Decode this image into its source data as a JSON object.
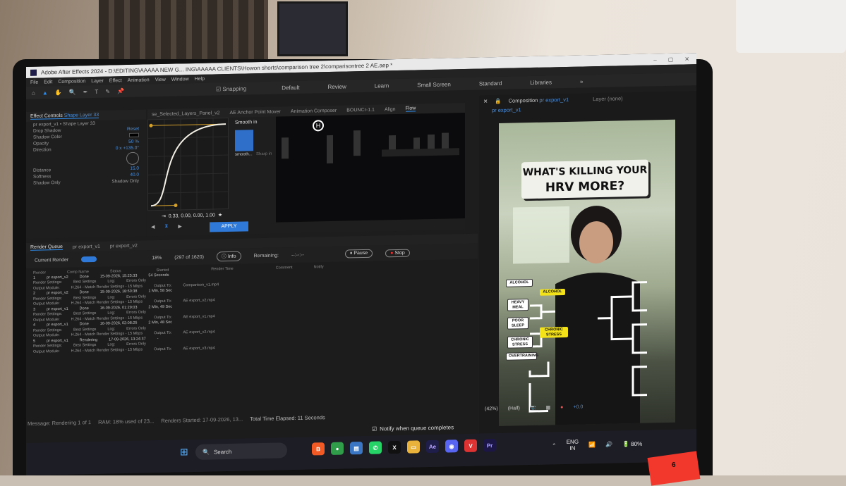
{
  "window": {
    "title": "Adobe After Effects 2024 - D:\\EDITING\\AAAAA NEW G... ING\\AAAAA CLIENTS\\Howon shorts\\comparison tree 2\\comparisontree 2 AE.aep *"
  },
  "menu": [
    "File",
    "Edit",
    "Composition",
    "Layer",
    "Effect",
    "Animation",
    "View",
    "Window",
    "Help"
  ],
  "toolbar": {
    "snapping": "Snapping",
    "workspaces": [
      "Default",
      "Review",
      "Learn",
      "Small Screen",
      "Standard",
      "Libraries"
    ]
  },
  "effect_controls": {
    "tab": "Effect Controls",
    "layer": "Shape Layer 33",
    "layer_path": "pr export_v1 • Shape Layer 33",
    "effect": "Drop Shadow",
    "reset": "Reset",
    "props": [
      {
        "label": "Shadow Color",
        "value": ""
      },
      {
        "label": "Opacity",
        "value": "50 %"
      },
      {
        "label": "Direction",
        "value": "0 x +135.0°"
      },
      {
        "label": "Distance",
        "value": "15.0"
      },
      {
        "label": "Softness",
        "value": "40.0"
      },
      {
        "label": "Shadow Only",
        "value": "Shadow Only"
      }
    ]
  },
  "flow": {
    "tabs": [
      "se_Selected_Layers_Panel_v2",
      "AE Anchor Point Mover",
      "Animation Composer",
      "BOUNCr-1.1",
      "Align",
      "Flow"
    ],
    "active_tab": "Flow",
    "preset_header": "Smooth in",
    "presets": [
      "smooth...",
      "Sharp in"
    ],
    "coords": "0.33, 0.00, 0.00, 1.00",
    "apply": "APPLY",
    "graph_p1": 0.33,
    "graph_p2": 0.0,
    "graph_p3": 0.0,
    "graph_p4": 1.0
  },
  "render_queue": {
    "tabs": [
      "Render Queue",
      "pr export_v1",
      "pr export_v2"
    ],
    "current_render": "Current Render",
    "percent": "18%",
    "frames": "(297 of 1620)",
    "info": "Info",
    "remaining_label": "Remaining:",
    "remaining": "--:--:--",
    "pause": "Pause",
    "stop": "Stop",
    "columns": [
      "Render",
      "Comp Name",
      "Status",
      "Started",
      "Render Time",
      "Comment",
      "Notify"
    ],
    "items": [
      {
        "num": "1",
        "comp": "pr export_v2",
        "status": "Done",
        "started": "15-09-2026, 15:25:33",
        "time": "54 Seconds",
        "log": "Errors Only",
        "output": "Comparison_v1.mp4"
      },
      {
        "num": "2",
        "comp": "pr export_v2",
        "status": "Done",
        "started": "15-09-2026, 18:50:38",
        "time": "1 Min, 58 Sec",
        "log": "Errors Only",
        "output": "AE export_v2.mp4"
      },
      {
        "num": "3",
        "comp": "pr export_v1",
        "status": "Done",
        "started": "16-09-2026, 01:29:03",
        "time": "2 Min, 49 Sec",
        "log": "Errors Only",
        "output": "AE export_v1.mp4"
      },
      {
        "num": "4",
        "comp": "pr export_v1",
        "status": "Done",
        "started": "16-09-2026, 02:08:25",
        "time": "2 Min, 48 Sec",
        "log": "Errors Only",
        "output": "AE export_v2.mp4"
      },
      {
        "num": "5",
        "comp": "pr export_v1",
        "status": "Rendering",
        "started": "17-09-2026, 13:24:37",
        "time": "-",
        "log": "Errors Only",
        "output": "AE export_v3.mp4"
      }
    ],
    "render_settings_label": "Render Settings:",
    "render_settings": "Best Settings",
    "output_module_label": "Output Module:",
    "output_module": "H.264 - Match Render Settings - 15 Mbps",
    "log_label": "Log:",
    "output_to_label": "Output To:",
    "message": "Message:  Rendering 1 of 1",
    "ram": "RAM:  18% used of 23...",
    "renders_started": "Renders Started:  17-09-2026, 13...",
    "elapsed": "Total Time Elapsed:  11 Seconds",
    "notify": "Notify when queue completes"
  },
  "composition": {
    "tab_prefix": "Composition",
    "tab_name": "pr export_v1",
    "layer_label": "Layer  (none)",
    "breadcrumb": "pr export_v1",
    "headline_line1": "WHAT'S KILLING YOUR",
    "headline_line2": "HRV MORE?",
    "tags": [
      "ALCOHOL",
      "ALCOHOL",
      "HEAVY MEAL",
      "POOR SLEEP",
      "CHRONIC STRESS",
      "CHRONIC STRESS",
      "OVERTRAINING"
    ],
    "zoom": "(42%)",
    "quality": "(Half)",
    "offset": "+0.0"
  },
  "video_logo": "H",
  "taskbar": {
    "search": "Search",
    "apps": [
      "Brave",
      "Chrome",
      "Files",
      "WhatsApp",
      "X",
      "Explorer",
      "After Effects",
      "Discord",
      "Vivaldi",
      "Premiere Pro"
    ],
    "lang_top": "ENG",
    "lang_bottom": "IN",
    "battery": "80%",
    "badge": "6"
  },
  "colors": {
    "accent": "#2f7ad9",
    "panel": "#1e1e1e",
    "yellow_tag": "#f3e21a"
  }
}
